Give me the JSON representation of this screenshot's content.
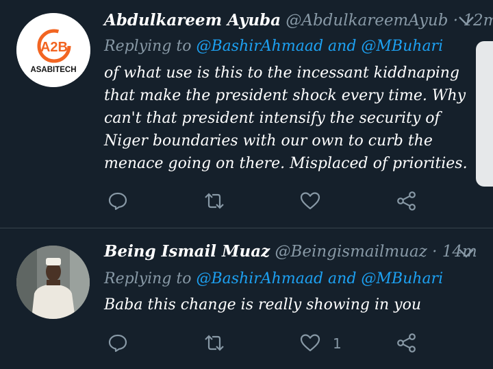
{
  "tweets": [
    {
      "name": "Abdulkareem Ayuba",
      "handle": "@AbdulkareemAyub",
      "separator": "·",
      "time": "12m",
      "replying_prefix": "Replying to",
      "mention1": "@BashirAhmaad",
      "and_word": "and",
      "mention2": "@MBuhari",
      "text": "of what use is this to the incessant kiddnaping that make the president shock every time. Why can't  that president  intensify the security  of Niger  boundaries with our own to curb the menace going  on there. Misplaced of priorities.",
      "avatar_logo_text": "ASABITECH",
      "avatar_logo_letters": "A2B"
    },
    {
      "name": "Being Ismail Muaz",
      "handle": "@Beingismailmuaz",
      "separator": "·",
      "time": "14m",
      "replying_prefix": "Replying to",
      "mention1": "@BashirAhmaad",
      "and_word": "and",
      "mention2": "@MBuhari",
      "text": "Baba  this change is really showing in you",
      "like_count": "1"
    }
  ],
  "icons": {
    "reply": "reply-icon",
    "retweet": "retweet-icon",
    "like": "heart-icon",
    "share": "share-icon",
    "menu": "chevron-down-icon"
  },
  "colors": {
    "background": "#15202b",
    "text_primary": "#ffffff",
    "text_secondary": "#8899a6",
    "link": "#1da1f2",
    "divider": "#38444d",
    "logo_orange": "#f26522"
  }
}
